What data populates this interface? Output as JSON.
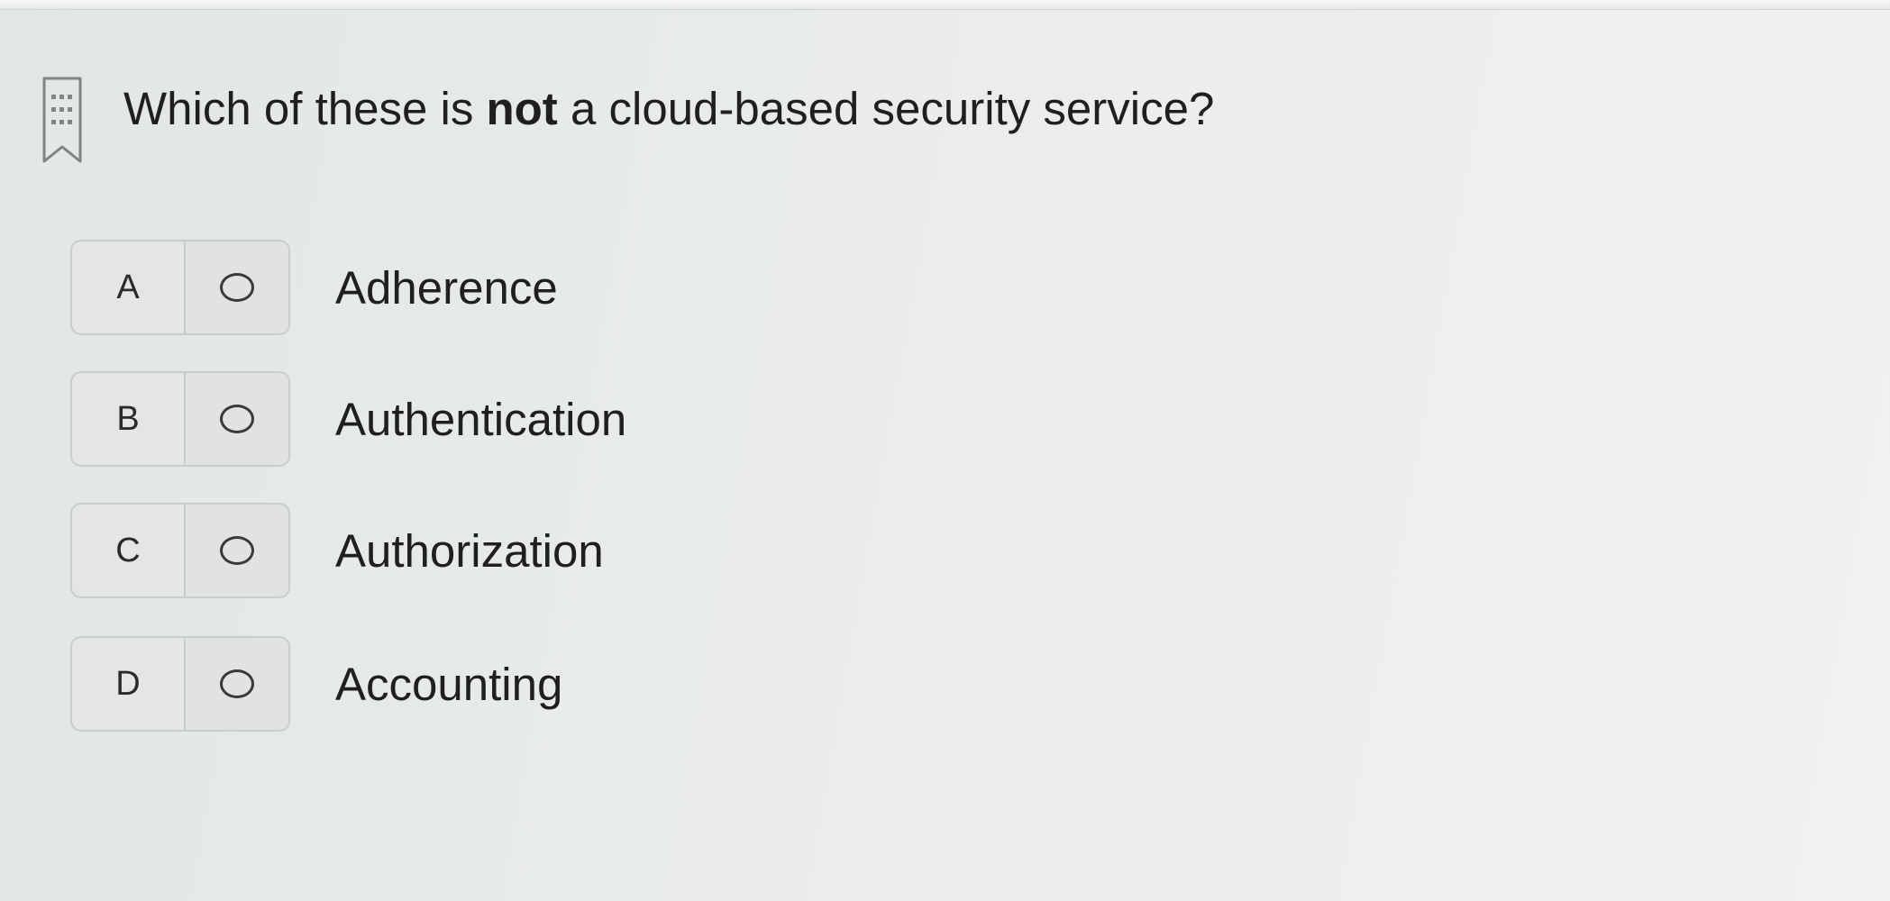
{
  "question": {
    "prefix": "Which of these is ",
    "emphasis": "not",
    "suffix": " a cloud-based security service?"
  },
  "icons": {
    "bookmark": "bookmark-flag-icon",
    "radio": "radio-button-icon"
  },
  "options": [
    {
      "letter": "A",
      "text": "Adherence"
    },
    {
      "letter": "B",
      "text": "Authentication"
    },
    {
      "letter": "C",
      "text": "Authorization"
    },
    {
      "letter": "D",
      "text": "Accounting"
    }
  ],
  "colors": {
    "background": "#e7ebe7",
    "text": "#1f1f1f",
    "option_border": "#c9cdc9"
  }
}
